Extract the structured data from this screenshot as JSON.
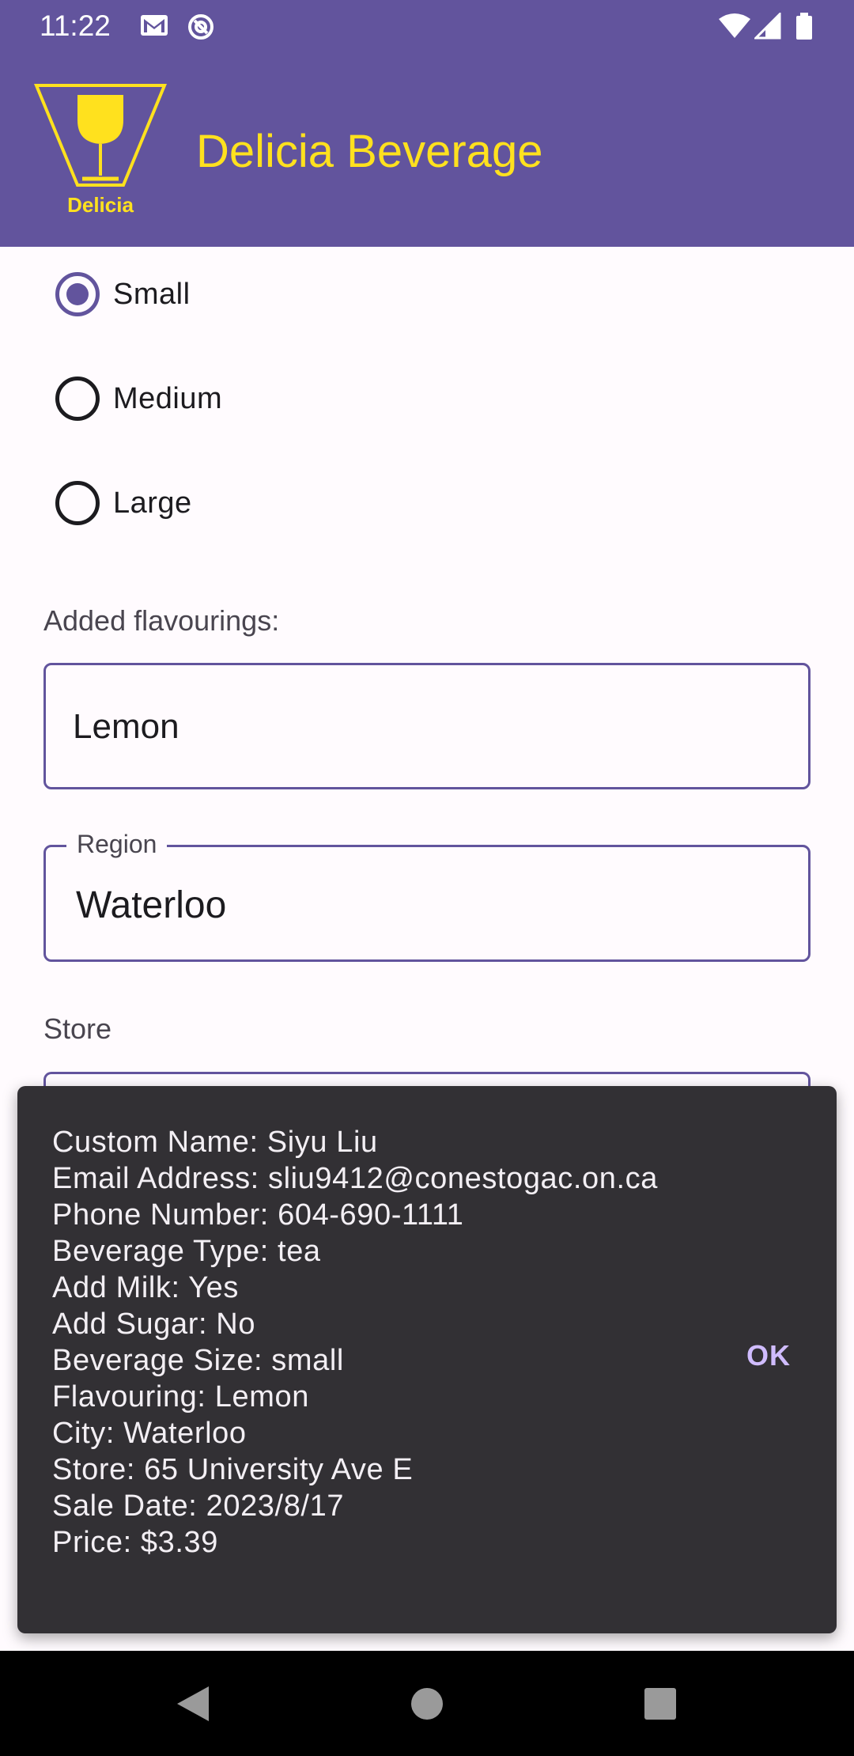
{
  "status_bar": {
    "time": "11:22",
    "left_icons": [
      "gmail-icon",
      "at-sign-icon"
    ],
    "right_icons": [
      "wifi-icon",
      "signal-icon",
      "battery-icon"
    ]
  },
  "app_bar": {
    "title": "Delicia Beverage",
    "logo_text": "Delicia",
    "background_color": "#62549d",
    "title_color": "#ffe11e"
  },
  "size_options": [
    {
      "label": "Small",
      "checked": true
    },
    {
      "label": "Medium",
      "checked": false
    },
    {
      "label": "Large",
      "checked": false
    }
  ],
  "flavourings": {
    "label": "Added flavourings:",
    "value": "Lemon"
  },
  "region": {
    "label": "Region",
    "value": "Waterloo"
  },
  "store": {
    "label": "Store"
  },
  "dialog": {
    "lines": [
      "Custom Name: Siyu Liu",
      "Email Address: sliu9412@conestogac.on.ca",
      "Phone Number: 604-690-1111",
      "Beverage Type: tea",
      "Add Milk: Yes",
      "Add Sugar: No",
      "Beverage Size: small",
      "Flavouring: Lemon",
      "City: Waterloo",
      "Store: 65 University Ave E",
      "Sale Date: 2023/8/17",
      "Price: $3.39"
    ],
    "ok_label": "OK"
  },
  "nav_bar": {
    "icons": [
      "back-icon",
      "home-icon",
      "recents-icon"
    ]
  }
}
